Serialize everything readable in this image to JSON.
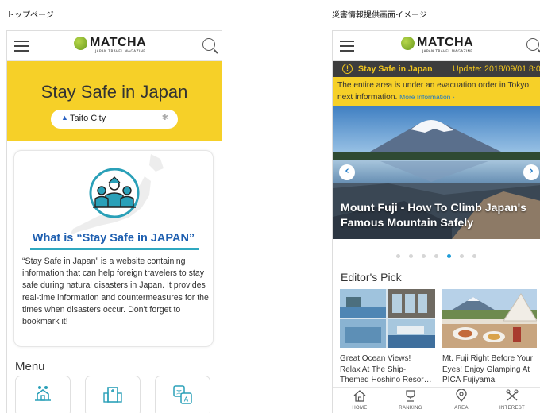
{
  "captions": {
    "left": "トップページ",
    "right": "災害情報提供画面イメージ"
  },
  "logo": {
    "brand": "MATCHA",
    "tagline": "JAPAN TRAVEL MAGAZINE"
  },
  "top_page": {
    "hero_title": "Stay Safe in Japan",
    "location": "Taito City",
    "card_heading": "What is “Stay Safe in JAPAN”",
    "card_text": "“Stay Safe in Japan” is a website containing information that can help foreign travelers to stay safe during natural disasters in Japan. It provides real-time information and countermeasures for the times when disasters occur.  Don't forget to bookmark it!",
    "menu_heading": "Menu",
    "menu_icons": [
      "evacuation-icon",
      "shelter-building-icon",
      "translation-icon"
    ]
  },
  "disaster_page": {
    "alert_title": "Stay Safe in Japan",
    "alert_update": "Update: 2018/09/01 8:00",
    "notice_text": "The entire area is under an evacuation order in Tokyo.",
    "notice_text2": "next information.",
    "notice_link": "More Information ›",
    "slide_title_line1": "Mount Fuji - How To Climb Japan's",
    "slide_title_line2": "Famous Mountain Safely",
    "slide_total": 7,
    "slide_active": 5,
    "editors_pick_heading": "Editor's Pick",
    "articles": [
      {
        "line1": "Great Ocean Views!",
        "line2": "Relax At The Ship-",
        "line3": "Themed Hoshino Resor…"
      },
      {
        "line1": "Mt. Fuji Right Before Your",
        "line2": "Eyes! Enjoy Glamping At",
        "line3": "PICA Fujiyama"
      }
    ],
    "tabs": [
      {
        "label": "HOME",
        "icon": "home-icon"
      },
      {
        "label": "RANKING",
        "icon": "trophy-icon"
      },
      {
        "label": "AREA",
        "icon": "map-pin-icon"
      },
      {
        "label": "INTEREST",
        "icon": "interest-icon"
      }
    ]
  },
  "colors": {
    "yellow": "#f6d028",
    "blue_heading": "#1e5fb0",
    "teal": "#2fa8c0",
    "alert_bg": "#3d3d3d",
    "link": "#1d78c6"
  }
}
